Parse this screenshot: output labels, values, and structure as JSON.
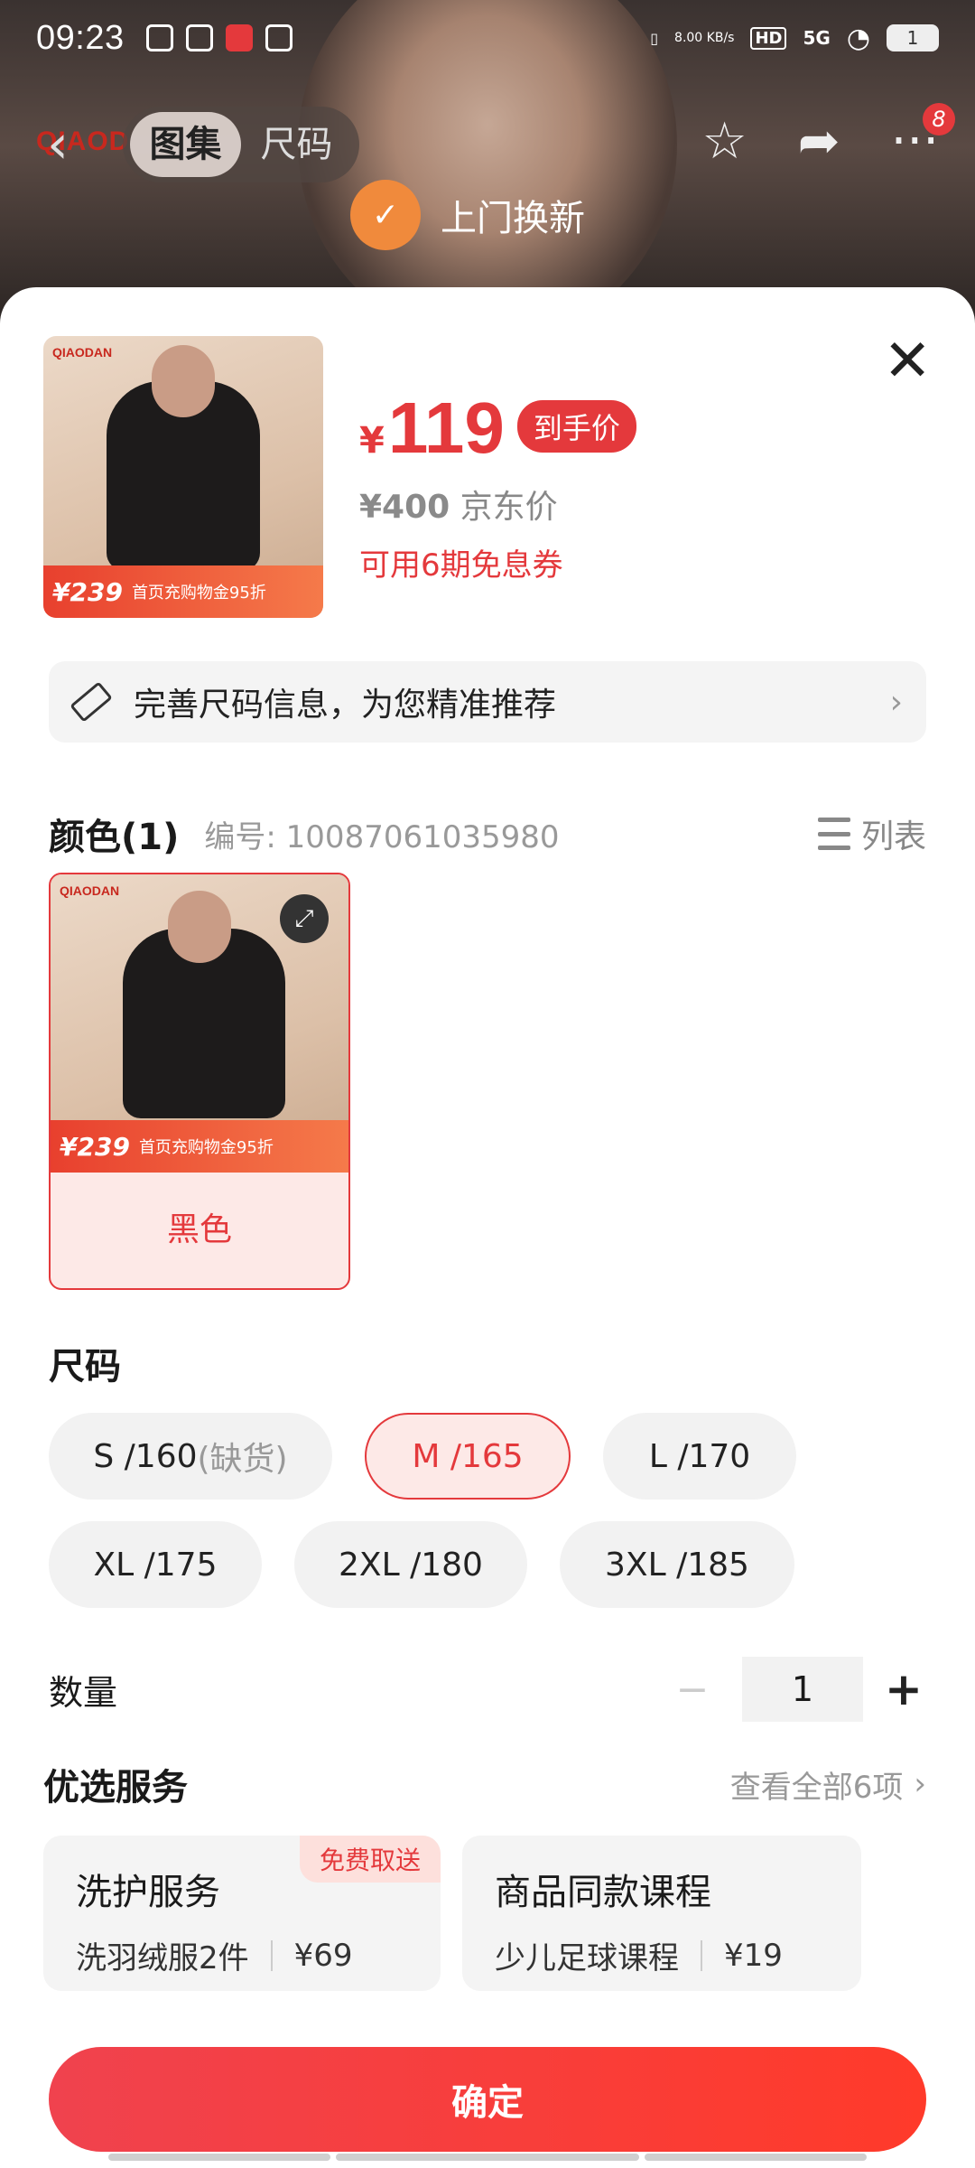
{
  "status_bar": {
    "time": "09:23",
    "net_speed": "8.00\nKB/s",
    "hd": "HD",
    "network": "5G",
    "battery": "1"
  },
  "nav": {
    "tabs": [
      "图集",
      "尺码"
    ],
    "active_tab": 0,
    "cart_badge": "8"
  },
  "hero": {
    "brand": "QIAOD",
    "service_tag": "上门换新"
  },
  "product": {
    "price_symbol": "¥",
    "price": "119",
    "price_tag": "到手价",
    "jd_price": "¥400",
    "jd_price_label": "京东价",
    "coupon": "可用6期免息券",
    "thumb_brand": "QIAODAN",
    "thumb_promo_price": "¥239",
    "thumb_promo_text": "首页充购物金95折"
  },
  "size_tip": {
    "text": "完善尺码信息，为您精准推荐"
  },
  "color_section": {
    "title": "颜色(1)",
    "sku_label": "编号: 10087061035980",
    "list_label": "列表",
    "options": [
      {
        "label": "黑色",
        "selected": true
      }
    ]
  },
  "size_section": {
    "title": "尺码",
    "options": [
      {
        "label": "S /160",
        "note": "(缺货)",
        "state": "out"
      },
      {
        "label": "M /165",
        "note": "",
        "state": "selected"
      },
      {
        "label": "L /170",
        "note": "",
        "state": "normal"
      },
      {
        "label": "XL /175",
        "note": "",
        "state": "normal"
      },
      {
        "label": "2XL /180",
        "note": "",
        "state": "normal"
      },
      {
        "label": "3XL /185",
        "note": "",
        "state": "normal"
      }
    ]
  },
  "quantity": {
    "label": "数量",
    "value": "1"
  },
  "services": {
    "title": "优选服务",
    "view_all": "查看全部6项",
    "cards": [
      {
        "name": "洗护服务",
        "item": "洗羽绒服2件",
        "price": "¥69",
        "tag": "免费取送"
      },
      {
        "name": "商品同款课程",
        "item": "少儿足球课程",
        "price": "¥19",
        "tag": ""
      }
    ]
  },
  "confirm_label": "确定",
  "colors": {
    "accent": "#e4393c",
    "accent_light": "#fde9e7"
  }
}
